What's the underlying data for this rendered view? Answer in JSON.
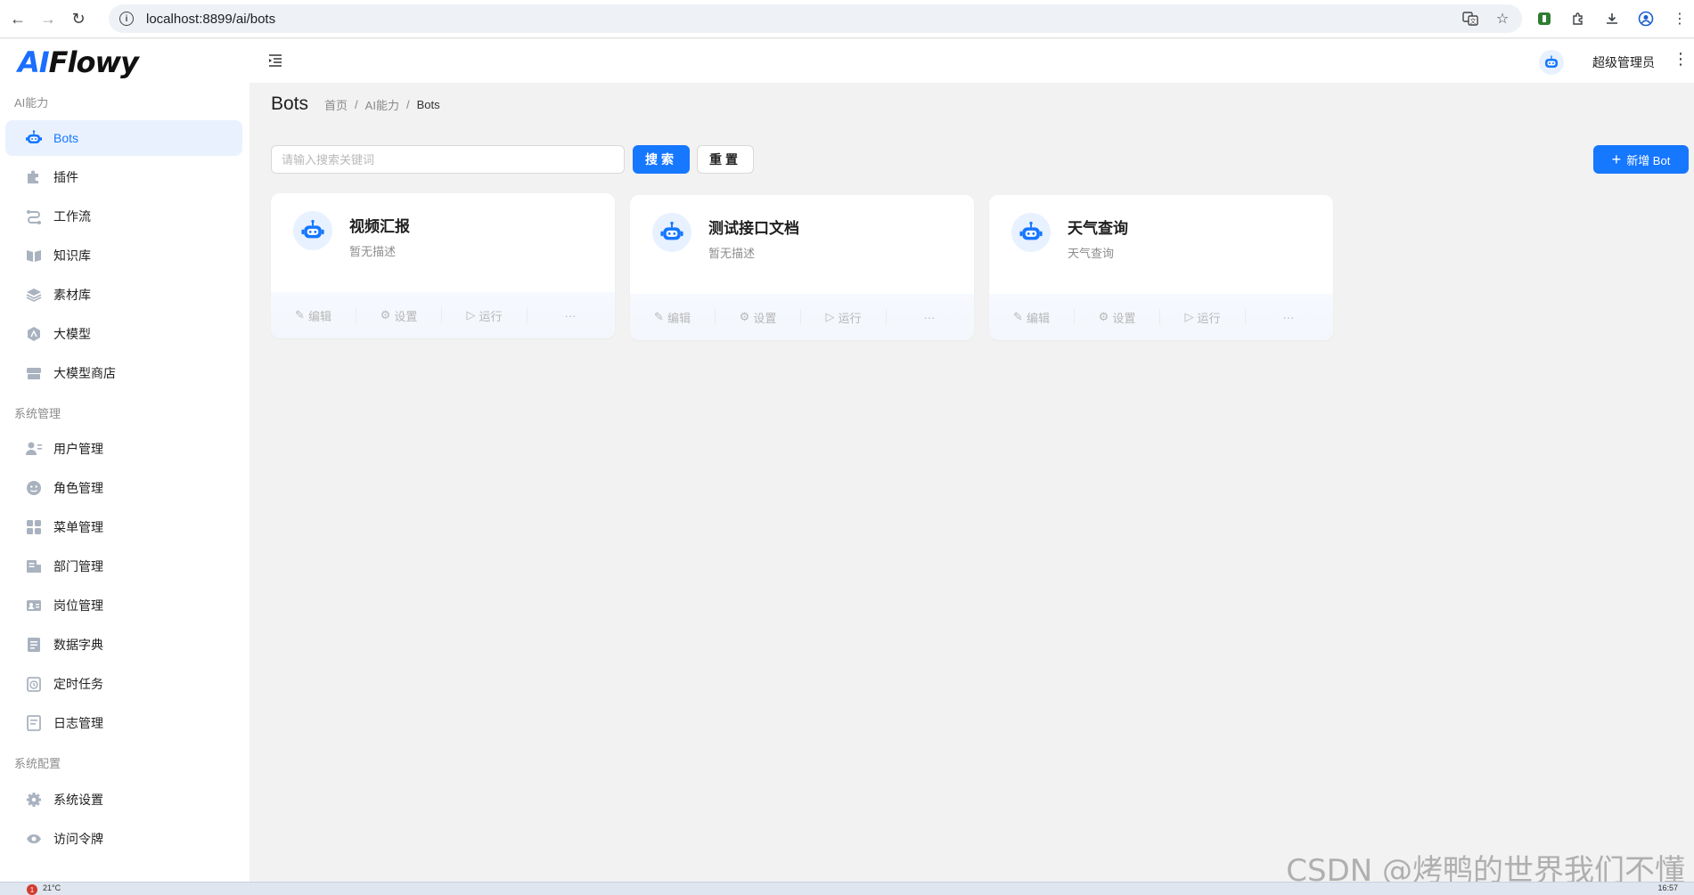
{
  "browser": {
    "url": "localhost:8899/ai/bots"
  },
  "app": {
    "logo_prefix": "AI",
    "logo_suffix": "Flowy",
    "user_name": "超级管理员"
  },
  "sidebar": {
    "sections": [
      {
        "title": "AI能力"
      },
      {
        "title": "系统管理"
      },
      {
        "title": "系统配置"
      }
    ],
    "items": [
      {
        "label": "Bots",
        "icon": "robot-icon"
      },
      {
        "label": "插件",
        "icon": "puzzle-icon"
      },
      {
        "label": "工作流",
        "icon": "workflow-icon"
      },
      {
        "label": "知识库",
        "icon": "book-icon"
      },
      {
        "label": "素材库",
        "icon": "layers-icon"
      },
      {
        "label": "大模型",
        "icon": "model-icon"
      },
      {
        "label": "大模型商店",
        "icon": "store-icon"
      },
      {
        "label": "用户管理",
        "icon": "user-icon"
      },
      {
        "label": "角色管理",
        "icon": "role-icon"
      },
      {
        "label": "菜单管理",
        "icon": "menu-grid-icon"
      },
      {
        "label": "部门管理",
        "icon": "department-icon"
      },
      {
        "label": "岗位管理",
        "icon": "id-card-icon"
      },
      {
        "label": "数据字典",
        "icon": "dictionary-icon"
      },
      {
        "label": "定时任务",
        "icon": "clock-icon"
      },
      {
        "label": "日志管理",
        "icon": "log-icon"
      },
      {
        "label": "系统设置",
        "icon": "gear-icon"
      },
      {
        "label": "访问令牌",
        "icon": "eye-icon"
      }
    ]
  },
  "page": {
    "title": "Bots",
    "breadcrumb": [
      "首页",
      "AI能力",
      "Bots"
    ],
    "breadcrumb_separator": "/"
  },
  "toolbar": {
    "search_placeholder": "请输入搜索关键词",
    "search_label": "搜索",
    "reset_label": "重置",
    "new_label": "新增 Bot",
    "new_icon": "+"
  },
  "cards": [
    {
      "name": "视频汇报",
      "description": "暂无描述"
    },
    {
      "name": "测试接口文档",
      "description": "暂无描述"
    },
    {
      "name": "天气查询",
      "description": "天气查询"
    }
  ],
  "card_actions": {
    "edit": "编辑",
    "settings": "设置",
    "run": "运行",
    "more": "···"
  },
  "watermark": "CSDN @烤鸭的世界我们不懂",
  "taskbar": {
    "badge": "1",
    "weather": "21°C",
    "time": "16:57"
  },
  "colors": {
    "primary": "#1677ff",
    "active_bg": "#e9f1ff",
    "page_bg": "#f2f2f2"
  }
}
